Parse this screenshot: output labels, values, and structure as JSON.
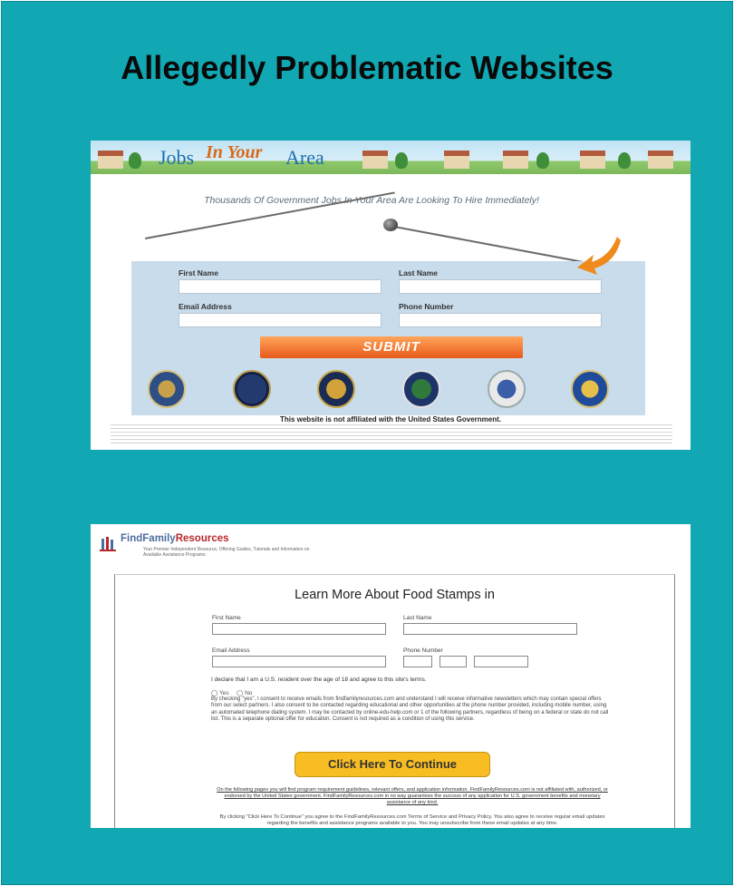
{
  "slide": {
    "title": "Allegedly Problematic Websites",
    "background_color": "#12a8b3"
  },
  "screenshot1": {
    "banner_logo": {
      "part1": "Jobs",
      "part2": "In Your",
      "part3": "Area"
    },
    "tagline": "Thousands Of Government Jobs In Your Area Are Looking To Hire Immediately!",
    "fields": {
      "first_name_label": "First Name",
      "last_name_label": "Last Name",
      "email_label": "Email Address",
      "phone_label": "Phone Number"
    },
    "submit_label": "SUBMIT",
    "disclaimer": "This website is not affiliated with the United States Government."
  },
  "screenshot2": {
    "logo": {
      "part1": "FindFamily",
      "part2": "Resources"
    },
    "logo_tagline": "Your Premier Independent Resource, Offering Guides, Tutorials and Information on Available Assistance Programs",
    "title": "Learn More About Food Stamps in",
    "fields": {
      "first_name_label": "First Name",
      "last_name_label": "Last Name",
      "email_label": "Email Address",
      "phone_label": "Phone Number"
    },
    "declaration": "I declare that I am a U.S. resident over the age of 18 and agree to this site's terms.",
    "radio_yes": "Yes",
    "radio_no": "No",
    "consent_text": "By checking \"yes\", I consent to receive emails from findfamilyresources.com and understand I will receive informative newsletters which may contain special offers from our select partners. I also consent to be contacted regarding educational and other opportunities at the phone number provided, including mobile number, using an automated telephone dialing system. I may be contacted by online-edu-help.com or 1 of the following partners, regardless of being on a federal or state do not call list. This is a separate optional offer for education. Consent is not required as a condition of using this service.",
    "continue_label": "Click Here To Continue",
    "info_text": "On the following pages you will find program requirement guidelines, relevant offers, and application information. FindFamilyResources.com is not affiliated with, authorized, or endorsed by the United States government. FindFamilyResources.com in no way guarantees the success of any application for U.S. government benefits and monetary assistance of any kind.",
    "terms_text": "By clicking \"Click Here To Continue\" you agree to the FindFamilyResources.com Terms of Service and Privacy Policy. You also agree to receive regular email updates regarding the benefits and assistance programs available to you. You may unsubscribe from these email updates at any time."
  }
}
